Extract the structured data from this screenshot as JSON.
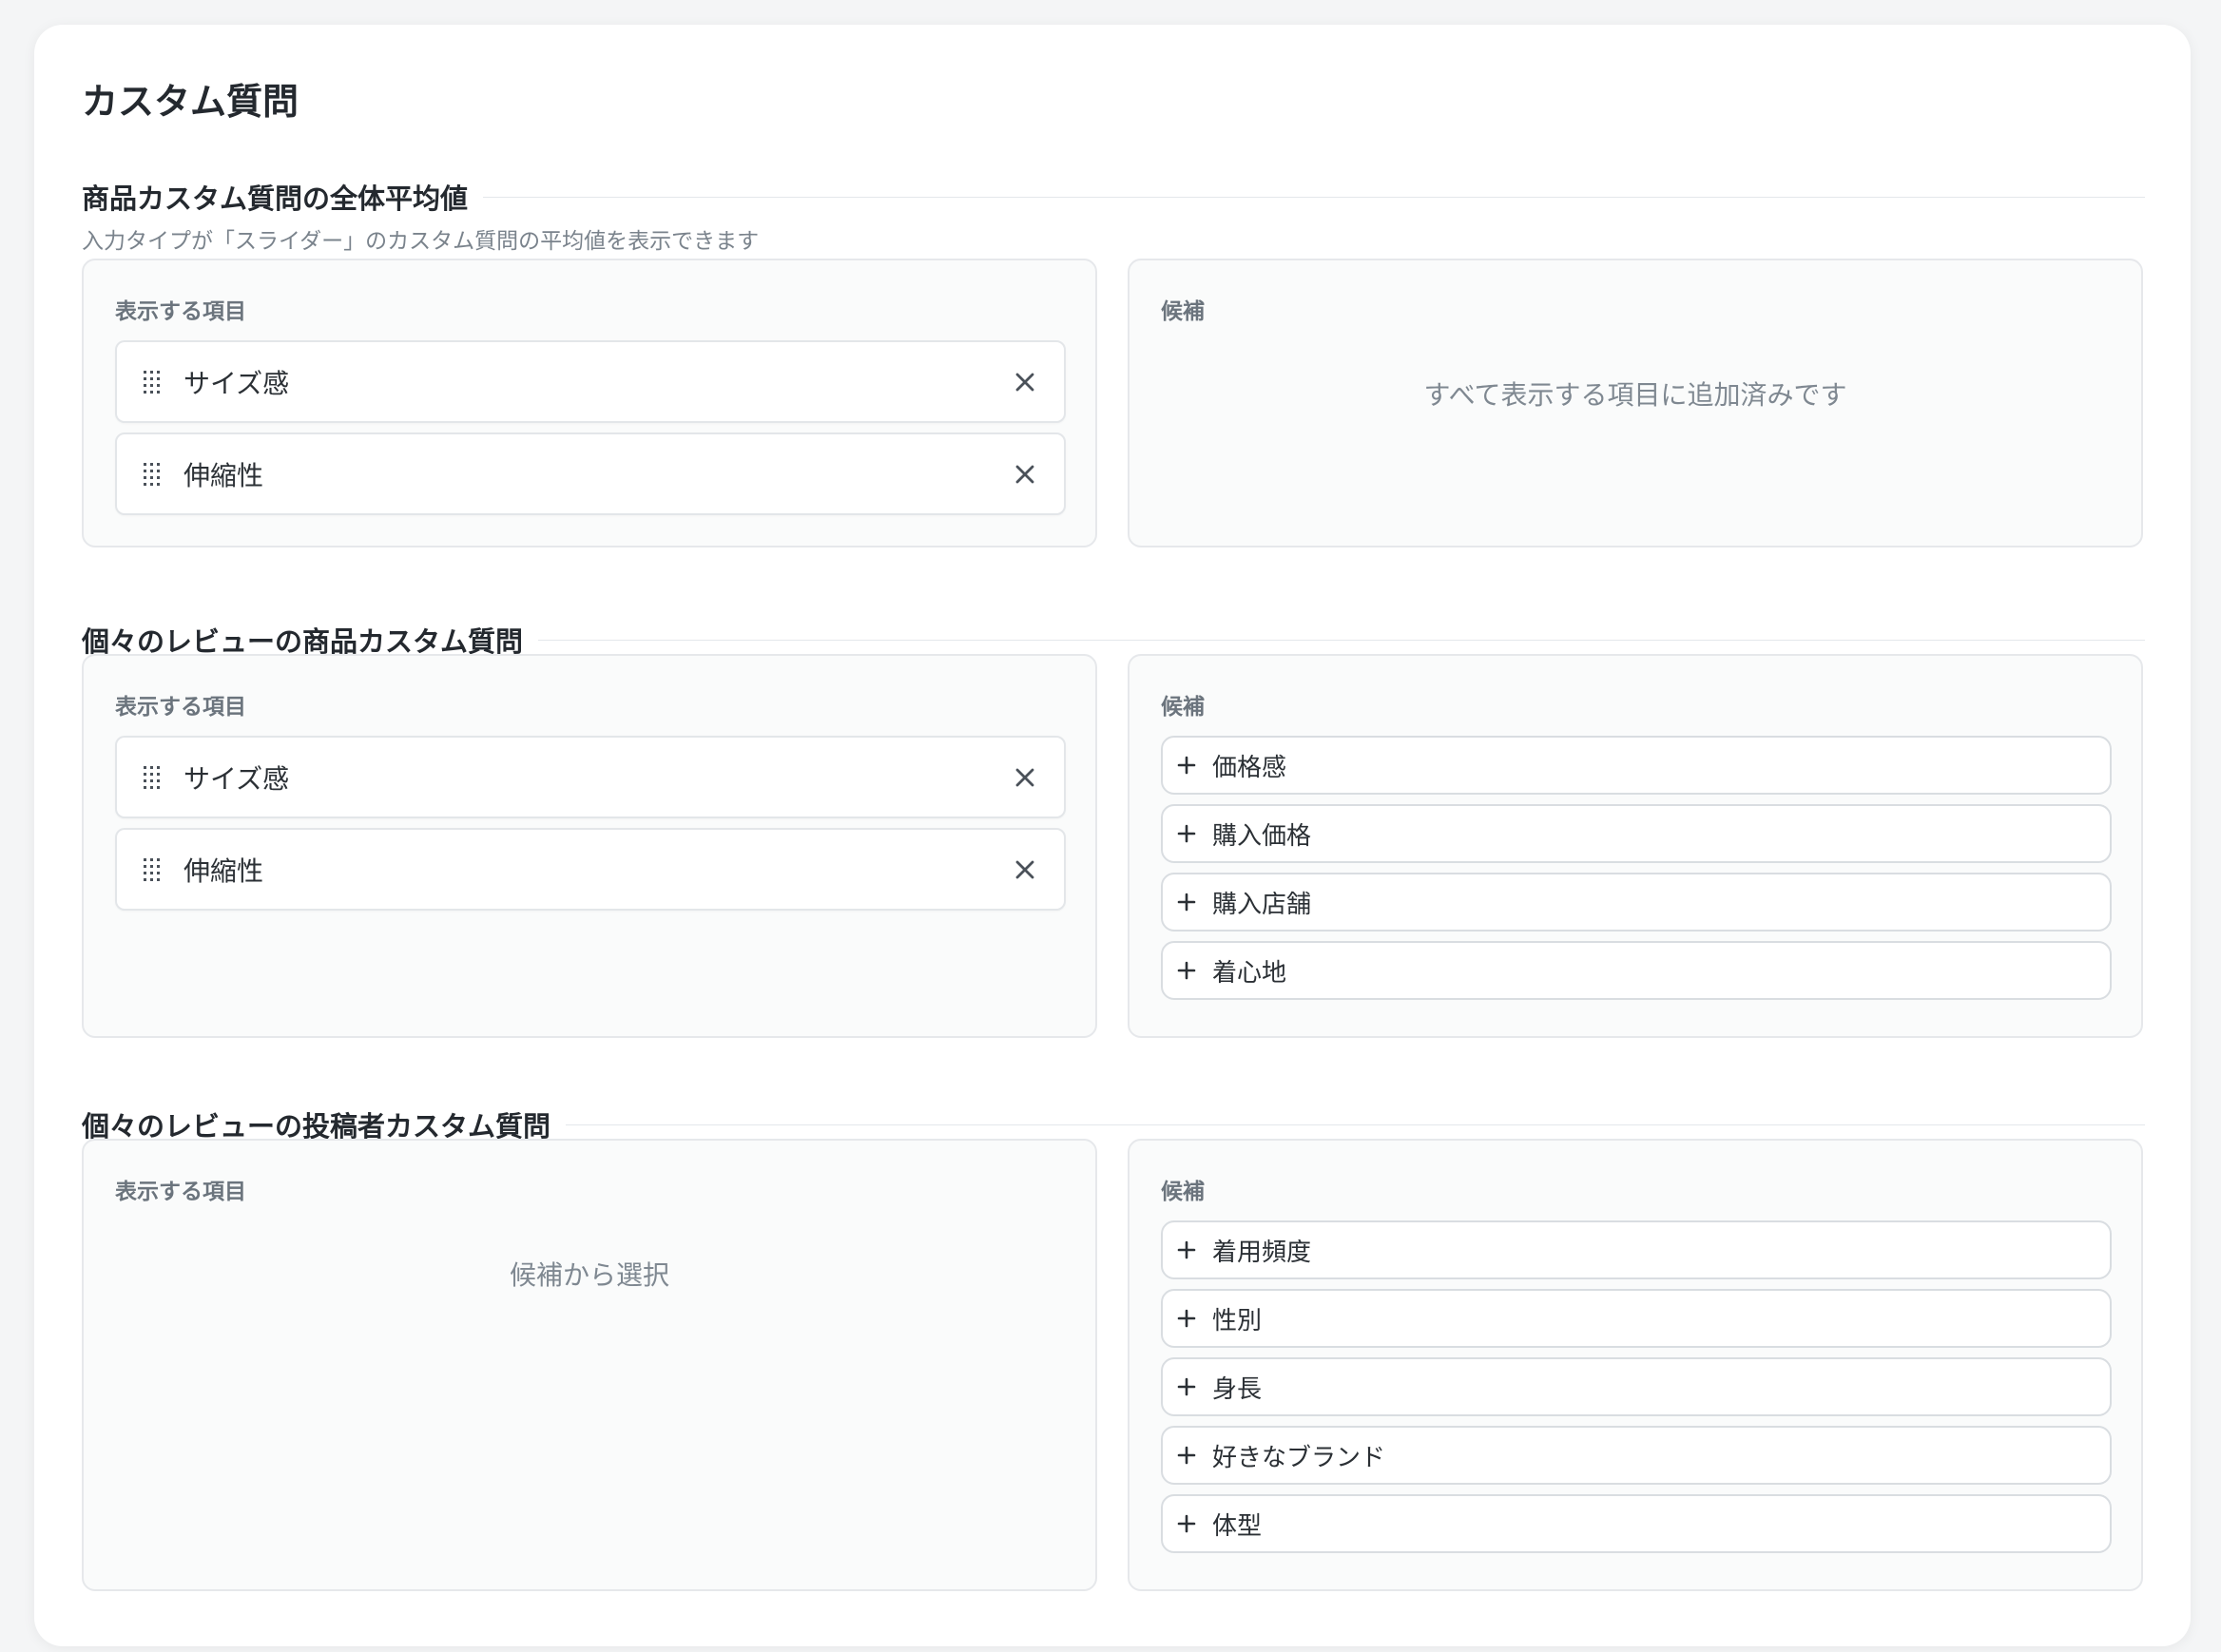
{
  "page": {
    "title": "カスタム質問"
  },
  "sections": [
    {
      "title": "商品カスタム質問の全体平均値",
      "description": "入力タイプが「スライダー」のカスタム質問の平均値を表示できます",
      "displayed_label": "表示する項目",
      "candidates_label": "候補",
      "displayed_items": [
        "サイズ感",
        "伸縮性"
      ],
      "candidates": [],
      "candidates_empty_text": "すべて表示する項目に追加済みです"
    },
    {
      "title": "個々のレビューの商品カスタム質問",
      "displayed_label": "表示する項目",
      "candidates_label": "候補",
      "displayed_items": [
        "サイズ感",
        "伸縮性"
      ],
      "candidates": [
        "価格感",
        "購入価格",
        "購入店舗",
        "着心地"
      ]
    },
    {
      "title": "個々のレビューの投稿者カスタム質問",
      "displayed_label": "表示する項目",
      "candidates_label": "候補",
      "displayed_items": [],
      "displayed_empty_text": "候補から選択",
      "candidates": [
        "着用頻度",
        "性別",
        "身長",
        "好きなブランド",
        "体型"
      ]
    }
  ],
  "icons": {
    "drag": "drag-handle-icon",
    "remove": "close-icon",
    "add": "plus-icon"
  },
  "colors": {
    "card_bg": "#ffffff",
    "panel_bg": "#fafbfb",
    "border": "#e6e8eb",
    "muted_text": "#7a838c"
  }
}
